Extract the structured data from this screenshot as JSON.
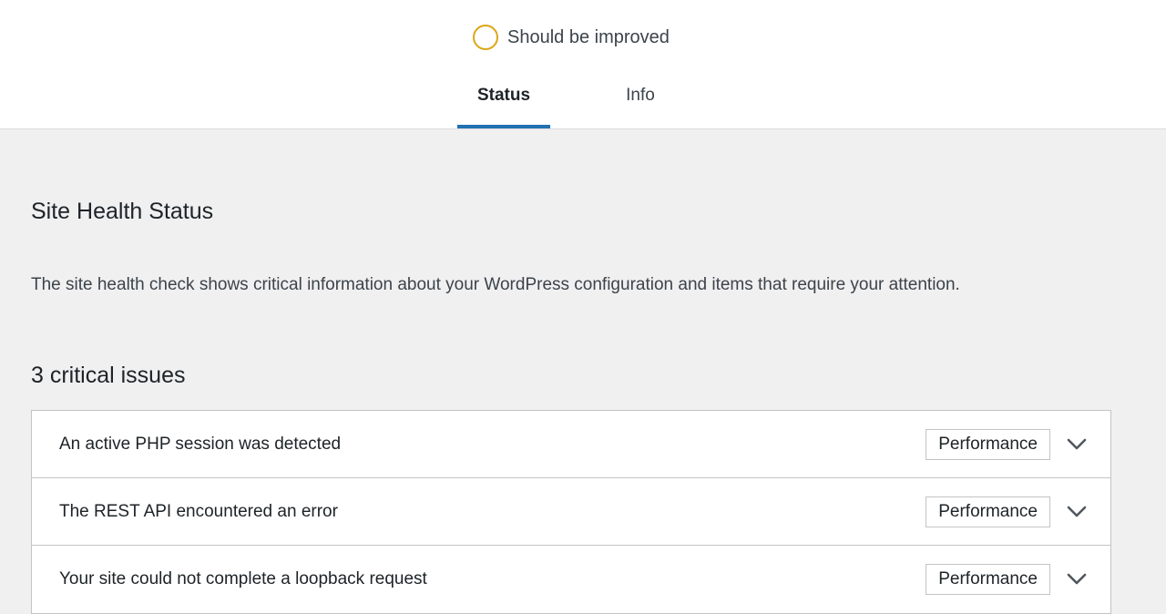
{
  "header": {
    "score_label": "Should be improved",
    "score_color": "#dba617",
    "tabs": [
      {
        "label": "Status",
        "active": true
      },
      {
        "label": "Info",
        "active": false
      }
    ]
  },
  "main": {
    "title": "Site Health Status",
    "description": "The site health check shows critical information about your WordPress configuration and items that require your attention.",
    "issues_heading": "3 critical issues",
    "issues": [
      {
        "label": "An active PHP session was detected",
        "badge": "Performance",
        "icon": "chevron-down-icon"
      },
      {
        "label": "The REST API encountered an error",
        "badge": "Performance",
        "icon": "chevron-down-icon"
      },
      {
        "label": "Your site could not complete a loopback request",
        "badge": "Performance",
        "icon": "chevron-down-icon"
      }
    ]
  },
  "colors": {
    "accent": "#2271b1",
    "warning": "#dba617"
  }
}
